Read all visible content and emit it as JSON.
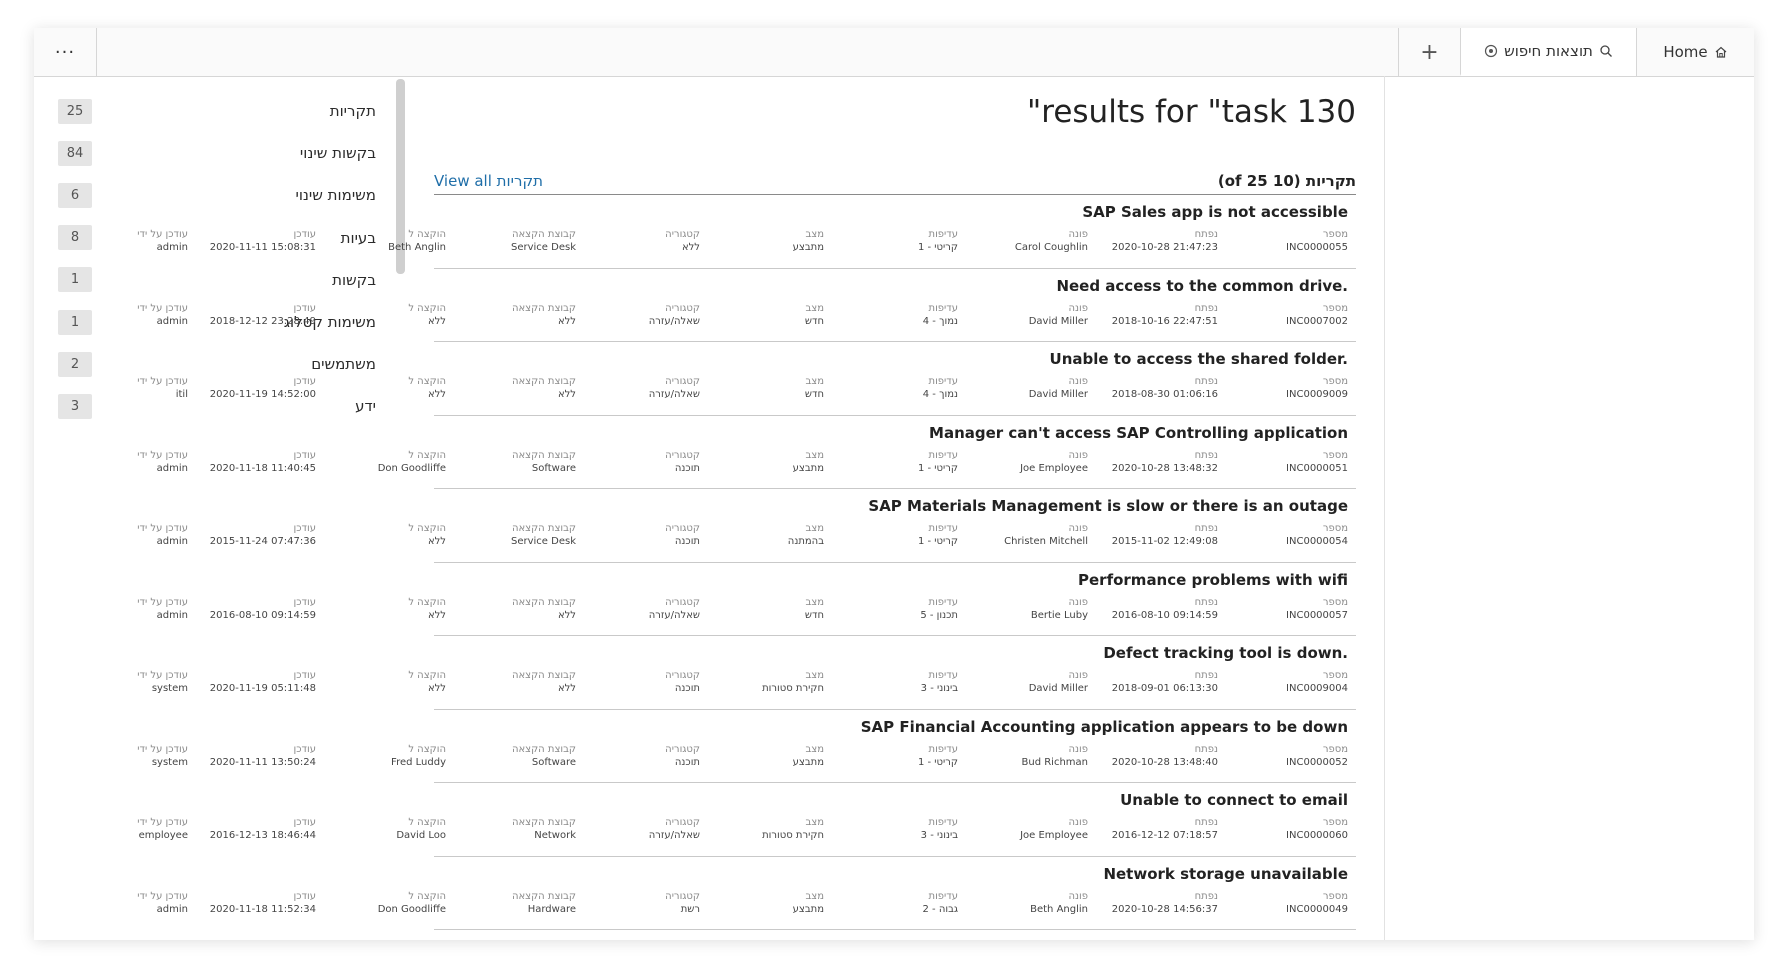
{
  "tabbar": {
    "more_label": "···",
    "add_label": "+",
    "search_tab_label": "תוצאות חיפוש",
    "home_label": "Home"
  },
  "page": {
    "title": "\"results for \"task 130",
    "section_title": "תקריות (10 of 25)",
    "view_all_label": "View all תקריות"
  },
  "columns": {
    "number": "מספר",
    "opened": "נפתח",
    "caller": "פונה",
    "priority": "עדיפות",
    "state": "מצב",
    "category": "קטגוריה",
    "assignment_group": "קבוצת הקצאה",
    "assigned_to": "הוקצה ל",
    "updated": "עודכן",
    "updated_by": "עודכן על ידי"
  },
  "results": [
    {
      "title": "SAP Sales app is not accessible",
      "number": "INC0000055",
      "opened": "2020-10-28 21:47:23",
      "caller": "Carol Coughlin",
      "priority": "1 - קריטי",
      "state": "מתבצע",
      "category": "ללא",
      "assignment_group": "Service Desk",
      "assigned_to": "Beth Anglin",
      "updated": "2020-11-11 15:08:31",
      "updated_by": "admin"
    },
    {
      "title": "Need access to the common drive.",
      "number": "INC0007002",
      "opened": "2018-10-16 22:47:51",
      "caller": "David Miller",
      "priority": "4 - נמוך",
      "state": "חדש",
      "category": "שאלה/עזרה",
      "assignment_group": "ללא",
      "assigned_to": "ללא",
      "updated": "2018-12-12 23:28:49",
      "updated_by": "admin"
    },
    {
      "title": "Unable to access the shared folder.",
      "number": "INC0009009",
      "opened": "2018-08-30 01:06:16",
      "caller": "David Miller",
      "priority": "4 - נמוך",
      "state": "חדש",
      "category": "שאלה/עזרה",
      "assignment_group": "ללא",
      "assigned_to": "ללא",
      "updated": "2020-11-19 14:52:00",
      "updated_by": "itil"
    },
    {
      "title": "Manager can't access SAP Controlling application",
      "number": "INC0000051",
      "opened": "2020-10-28 13:48:32",
      "caller": "Joe Employee",
      "priority": "1 - קריטי",
      "state": "מתבצע",
      "category": "תוכנה",
      "assignment_group": "Software",
      "assigned_to": "Don Goodliffe",
      "updated": "2020-11-18 11:40:45",
      "updated_by": "admin"
    },
    {
      "title": "SAP Materials Management is slow or there is an outage",
      "number": "INC0000054",
      "opened": "2015-11-02 12:49:08",
      "caller": "Christen Mitchell",
      "priority": "1 - קריטי",
      "state": "בהמתנה",
      "category": "תוכנה",
      "assignment_group": "Service Desk",
      "assigned_to": "ללא",
      "updated": "2015-11-24 07:47:36",
      "updated_by": "admin"
    },
    {
      "title": "Performance problems with wifi",
      "number": "INC0000057",
      "opened": "2016-08-10 09:14:59",
      "caller": "Bertie Luby",
      "priority": "5 - תכנון",
      "state": "חדש",
      "category": "שאלה/עזרה",
      "assignment_group": "ללא",
      "assigned_to": "ללא",
      "updated": "2016-08-10 09:14:59",
      "updated_by": "admin"
    },
    {
      "title": "Defect tracking tool is down.",
      "number": "INC0009004",
      "opened": "2018-09-01 06:13:30",
      "caller": "David Miller",
      "priority": "3 - בינוני",
      "state": "חקירת סטורות",
      "category": "תוכנה",
      "assignment_group": "ללא",
      "assigned_to": "ללא",
      "updated": "2020-11-19 05:11:48",
      "updated_by": "system"
    },
    {
      "title": "SAP Financial Accounting application appears to be down",
      "number": "INC0000052",
      "opened": "2020-10-28 13:48:40",
      "caller": "Bud Richman",
      "priority": "1 - קריטי",
      "state": "מתבצע",
      "category": "תוכנה",
      "assignment_group": "Software",
      "assigned_to": "Fred Luddy",
      "updated": "2020-11-11 13:50:24",
      "updated_by": "system"
    },
    {
      "title": "Unable to connect to email",
      "number": "INC0000060",
      "opened": "2016-12-12 07:18:57",
      "caller": "Joe Employee",
      "priority": "3 - בינוני",
      "state": "חקירת סטורות",
      "category": "שאלה/עזרה",
      "assignment_group": "Network",
      "assigned_to": "David Loo",
      "updated": "2016-12-13 18:46:44",
      "updated_by": "employee"
    },
    {
      "title": "Network storage unavailable",
      "number": "INC0000049",
      "opened": "2020-10-28 14:56:37",
      "caller": "Beth Anglin",
      "priority": "2 - גבוה",
      "state": "מתבצע",
      "category": "רשת",
      "assignment_group": "Hardware",
      "assigned_to": "Don Goodliffe",
      "updated": "2020-11-18 11:52:34",
      "updated_by": "admin"
    }
  ],
  "sidebar": {
    "categories": [
      {
        "label": "תקריות",
        "count": "25"
      },
      {
        "label": "בקשות שינוי",
        "count": "84"
      },
      {
        "label": "משימות שינוי",
        "count": "6"
      },
      {
        "label": "בעיות",
        "count": "8"
      },
      {
        "label": "בקשות",
        "count": "1"
      },
      {
        "label": "משימות קטלוג",
        "count": "1"
      },
      {
        "label": "משתמשים",
        "count": "2"
      },
      {
        "label": "ידע",
        "count": "3"
      }
    ]
  },
  "colors": {
    "link": "#1f6ea8",
    "badge_bg": "#e5e5e5",
    "divider": "#c9c9c9"
  },
  "icons": {
    "more": "ellipsis-icon",
    "add": "plus-icon",
    "close": "close-circle-icon",
    "search": "search-icon",
    "home": "home-icon"
  }
}
